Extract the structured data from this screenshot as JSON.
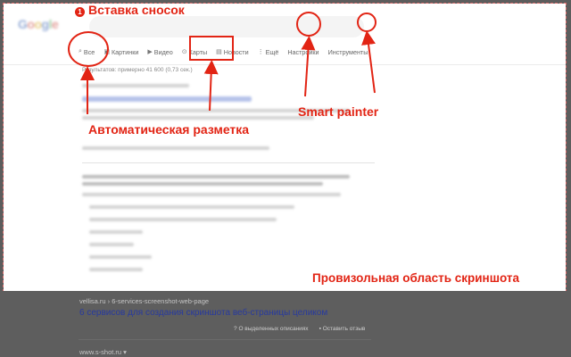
{
  "annotations": {
    "badge_number": "1",
    "insert_footnotes": "Вставка сносок",
    "auto_markup": "Автоматическая разметка",
    "smart_painter": "Smart painter",
    "arbitrary_area": "Провизольная область скриншота"
  },
  "search_page": {
    "logo_letters": [
      "G",
      "o",
      "o",
      "g",
      "l",
      "e"
    ],
    "tabs": [
      {
        "label": "Все",
        "icon": "search-icon"
      },
      {
        "label": "Картинки",
        "icon": "image-icon"
      },
      {
        "label": "Видео",
        "icon": "video-icon"
      },
      {
        "label": "Карты",
        "icon": "map-pin-icon"
      },
      {
        "label": "Новости",
        "icon": "news-icon"
      },
      {
        "label": "Ещё",
        "icon": "more-icon"
      },
      {
        "label": "Настройки",
        "icon": ""
      },
      {
        "label": "Инструменты",
        "icon": ""
      }
    ],
    "results_count": "Результатов: примерно 41 600 (0,73 сек.)"
  },
  "below_area": {
    "url": "vellisa.ru › 6-services-screenshot-web-page",
    "title": "6 сервисов для создания скриншота веб-страницы целиком",
    "meta_1": "О выделенных описаниях",
    "meta_2": "Оставить отзыв",
    "next_url": "www.s-shot.ru ▾"
  },
  "colors": {
    "accent": "#e22414",
    "overlay": "#5d5d5d",
    "link": "#283a9e"
  }
}
